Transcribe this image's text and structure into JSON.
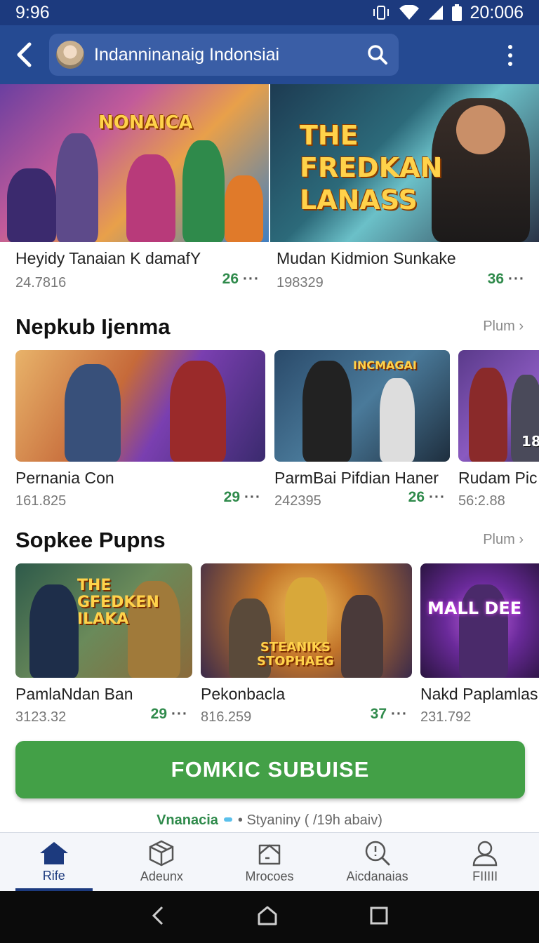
{
  "status": {
    "time": "9:96",
    "right_time": "20:006"
  },
  "app_bar": {
    "search_text": "Indanninanaig Indonsiai"
  },
  "banners": [
    {
      "art_title": "NONAICA",
      "title": "Heyidy Tanaian K damafY",
      "sub": "24.7816",
      "score": "26",
      "dots": "···"
    },
    {
      "art_title": "THE\nFREDKAN\nLANASS",
      "title": "Mudan Kidmion Sunkake",
      "sub": "198329",
      "score": "36",
      "dots": "···"
    }
  ],
  "section1": {
    "title": "Nepkub Ijenma",
    "more": "Plum ›",
    "cards": [
      {
        "title": "Pernania Con",
        "sub": "161.825",
        "score": "29",
        "dots": "···"
      },
      {
        "art_title": "INCMAGAI",
        "title": "ParmBai Pifdian Haner",
        "sub": "242395",
        "score": "26",
        "dots": "···"
      },
      {
        "art_title": "18",
        "title": "Rudam Pic",
        "sub": "56:2.88"
      }
    ]
  },
  "section2": {
    "title": "Sopkee Pupns",
    "more": "Plum ›",
    "cards": [
      {
        "art_title": "THE\nGFEDKEN\nILAKA",
        "title": "PamlaNdan Ban",
        "sub": "3123.32",
        "score": "29",
        "dots": "···"
      },
      {
        "art_title": "STEANIKS\nSTOPHAEG",
        "title": "Pekonbacla",
        "sub": "816.259",
        "score": "37",
        "dots": "···"
      },
      {
        "art_title": "MALL DEE",
        "title": "Nakd Paplamlas",
        "sub": "231.792"
      }
    ]
  },
  "cta": {
    "label": "FOMKIC SUBUISE"
  },
  "footer": {
    "brand": "Vnanacia",
    "text": "Styaniny ( /19h abaiv)"
  },
  "bottom_nav": [
    {
      "label": "Rife",
      "icon": "home-icon",
      "active": true
    },
    {
      "label": "Adeunx",
      "icon": "cube-icon"
    },
    {
      "label": "Mrocoes",
      "icon": "bag-icon"
    },
    {
      "label": "Aicdanaias",
      "icon": "search-icon"
    },
    {
      "label": "FIIIII",
      "icon": "person-icon"
    }
  ],
  "colors": {
    "status_bar": "#1c3a7e",
    "app_bar": "#254a92",
    "accent_green": "#43a047",
    "score_green": "#2f8a4b"
  }
}
